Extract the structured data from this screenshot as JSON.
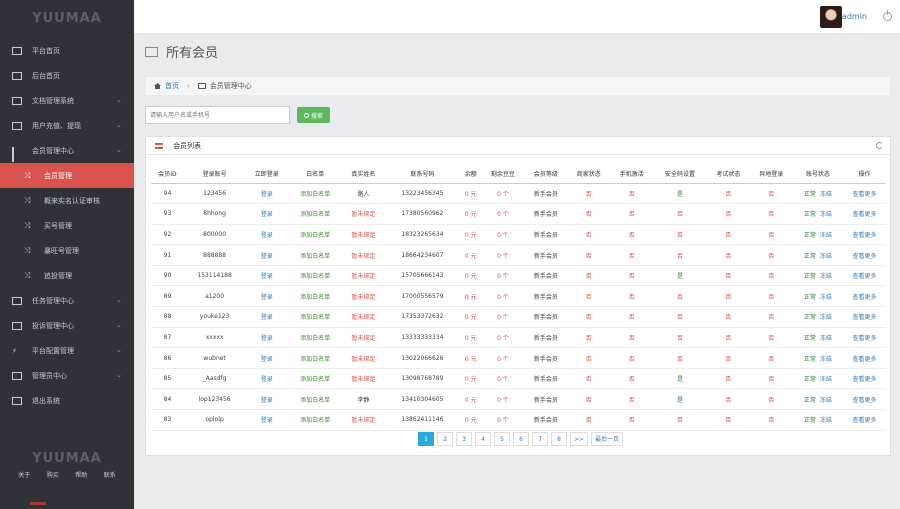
{
  "brand": "YUUMAA",
  "sidebar": {
    "items": [
      {
        "label": "平台首页",
        "icon": "monitor-icon",
        "sub": false,
        "active": false,
        "chevron": false
      },
      {
        "label": "后台首页",
        "icon": "monitor-icon",
        "sub": false,
        "active": false,
        "chevron": false
      },
      {
        "label": "文档管理系统",
        "icon": "document-icon",
        "sub": false,
        "active": false,
        "chevron": true
      },
      {
        "label": "用户充值、提现",
        "icon": "card-icon",
        "sub": false,
        "active": false,
        "chevron": true
      },
      {
        "label": "会员管理中心",
        "icon": "bar-chart-icon",
        "sub": false,
        "active": false,
        "chevron": true
      },
      {
        "label": "会员管理",
        "icon": "shuffle-icon",
        "sub": true,
        "active": true,
        "chevron": false
      },
      {
        "label": "概来实名认证审核",
        "icon": "shuffle-icon",
        "sub": true,
        "active": false,
        "chevron": false
      },
      {
        "label": "买号管理",
        "icon": "shuffle-icon",
        "sub": true,
        "active": false,
        "chevron": false
      },
      {
        "label": "暴旺号管理",
        "icon": "shuffle-icon",
        "sub": true,
        "active": false,
        "chevron": false
      },
      {
        "label": "追投管理",
        "icon": "shuffle-icon",
        "sub": true,
        "active": false,
        "chevron": false
      },
      {
        "label": "任务管理中心",
        "icon": "briefcase-icon",
        "sub": false,
        "active": false,
        "chevron": true
      },
      {
        "label": "投诉管理中心",
        "icon": "briefcase-icon",
        "sub": false,
        "active": false,
        "chevron": true
      },
      {
        "label": "平台配置管理",
        "icon": "bolt-icon",
        "sub": false,
        "active": false,
        "chevron": true
      },
      {
        "label": "管理员中心",
        "icon": "briefcase-icon",
        "sub": false,
        "active": false,
        "chevron": true
      },
      {
        "label": "退出系统",
        "icon": "calendar-icon",
        "sub": false,
        "active": false,
        "chevron": false
      }
    ],
    "footer_brand": "YUUMAA",
    "footer_links": [
      "关于",
      "购买",
      "帮助",
      "联系"
    ]
  },
  "topbar": {
    "username": "admin"
  },
  "page_title": "所有会员",
  "breadcrumb": {
    "home": "首页",
    "current": "会员管理中心"
  },
  "search": {
    "placeholder": "请输入用户名或手机号",
    "button_label": "搜索"
  },
  "panel_title": "会员列表",
  "table": {
    "headers": [
      "会员ID",
      "登录账号",
      "立即登录",
      "白名单",
      "真实姓名",
      "联系号码",
      "余额",
      "剩余豆豆",
      "会员等级",
      "商家状态",
      "手机激活",
      "安全码设置",
      "考试状态",
      "异地登录",
      "账号状态",
      "操作"
    ],
    "rows": [
      [
        "94",
        "123456",
        "登录",
        "添加白名单",
        "路人",
        "13223456345",
        "0 元",
        "0 个",
        "新手会员",
        "否",
        "否",
        "是",
        "否",
        "否",
        "正常",
        "冻结",
        "查看更多"
      ],
      [
        "93",
        "8hhong",
        "登录",
        "添加白名单",
        "暂未绑定",
        "17380560962",
        "0 元",
        "0 个",
        "新手会员",
        "否",
        "否",
        "否",
        "否",
        "否",
        "正常",
        "冻结",
        "查看更多"
      ],
      [
        "92",
        "800000",
        "登录",
        "添加白名单",
        "暂未绑定",
        "18323265634",
        "0 元",
        "0 个",
        "新手会员",
        "否",
        "否",
        "否",
        "否",
        "否",
        "正常",
        "冻结",
        "查看更多"
      ],
      [
        "91",
        "888888",
        "登录",
        "添加白名单",
        "暂未绑定",
        "18664234607",
        "0 元",
        "0 个",
        "新手会员",
        "否",
        "否",
        "否",
        "否",
        "否",
        "正常",
        "冻结",
        "查看更多"
      ],
      [
        "90",
        "153114188",
        "登录",
        "添加白名单",
        "暂未绑定",
        "15705666143",
        "0 元",
        "0 个",
        "新手会员",
        "否",
        "否",
        "是",
        "否",
        "否",
        "正常",
        "冻结",
        "查看更多"
      ],
      [
        "89",
        "a1200",
        "登录",
        "添加白名单",
        "暂未绑定",
        "17000556579",
        "0 元",
        "0 个",
        "新手会员",
        "否",
        "否",
        "否",
        "否",
        "否",
        "正常",
        "冻结",
        "查看更多"
      ],
      [
        "88",
        "youke123",
        "登录",
        "添加白名单",
        "暂未绑定",
        "17353372632",
        "0 元",
        "0 个",
        "新手会员",
        "否",
        "否",
        "否",
        "否",
        "否",
        "正常",
        "冻结",
        "查看更多"
      ],
      [
        "87",
        "xxxxx",
        "登录",
        "添加白名单",
        "暂未绑定",
        "13333333334",
        "0 元",
        "0 个",
        "新手会员",
        "否",
        "否",
        "否",
        "否",
        "否",
        "正常",
        "冻结",
        "查看更多"
      ],
      [
        "86",
        "wubnet",
        "登录",
        "添加白名单",
        "暂未绑定",
        "13022066626",
        "0 元",
        "0 个",
        "新手会员",
        "否",
        "否",
        "否",
        "否",
        "否",
        "正常",
        "冻结",
        "查看更多"
      ],
      [
        "85",
        "_Aasdfg",
        "登录",
        "添加白名单",
        "暂未绑定",
        "13098768789",
        "0 元",
        "0 个",
        "新手会员",
        "否",
        "否",
        "是",
        "否",
        "否",
        "正常",
        "冻结",
        "查看更多"
      ],
      [
        "84",
        "lop123456",
        "登录",
        "添加白名单",
        "李静",
        "13410304605",
        "0 元",
        "0 个",
        "新手会员",
        "否",
        "否",
        "是",
        "否",
        "否",
        "正常",
        "冻结",
        "查看更多"
      ],
      [
        "83",
        "oplolp",
        "登录",
        "添加白名单",
        "暂未绑定",
        "13862411146",
        "0 元",
        "0 个",
        "新手会员",
        "否",
        "否",
        "否",
        "否",
        "否",
        "正常",
        "冻结",
        "查看更多"
      ]
    ]
  },
  "pagination": {
    "pages": [
      "1",
      "2",
      "3",
      "4",
      "5",
      "6",
      "7",
      "8",
      ">>",
      "最后一页"
    ],
    "active": "1"
  },
  "colors": {
    "sidebar_bg": "#2f3236",
    "active_item": "#d9534f",
    "link": "#337ab7",
    "success": "#5cb85c",
    "danger": "#d9534f"
  }
}
